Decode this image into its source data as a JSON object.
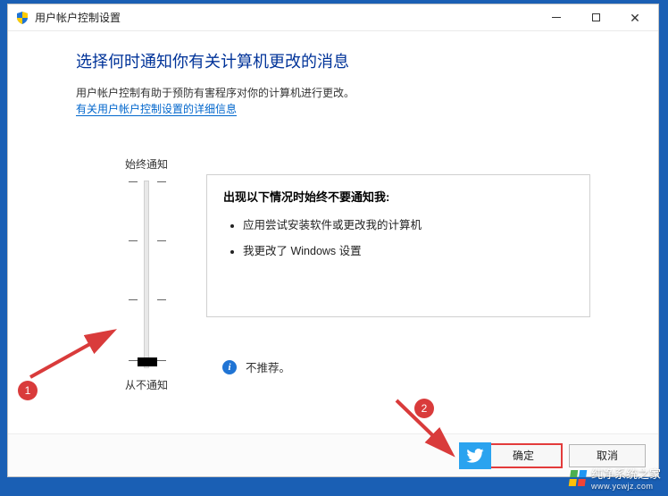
{
  "window": {
    "title": "用户帐户控制设置",
    "controls": {
      "minimize": "–",
      "maximize": "□",
      "close": "✕"
    }
  },
  "main": {
    "heading": "选择何时通知你有关计算机更改的消息",
    "subtext": "用户帐户控制有助于预防有害程序对你的计算机进行更改。",
    "link": "有关用户帐户控制设置的详细信息"
  },
  "slider": {
    "top_label": "始终通知",
    "bottom_label": "从不通知",
    "levels": 4,
    "value_index": 3
  },
  "panel": {
    "title": "出现以下情况时始终不要通知我:",
    "items": [
      "应用尝试安装软件或更改我的计算机",
      "我更改了 Windows 设置"
    ]
  },
  "note": {
    "icon": "info-icon",
    "text": "不推荐。"
  },
  "footer": {
    "ok": "确定",
    "cancel": "取消"
  },
  "annotations": {
    "badge1": "1",
    "badge2": "2"
  },
  "watermark": {
    "name": "纯净系统之家",
    "url": "www.ycwjz.com"
  }
}
